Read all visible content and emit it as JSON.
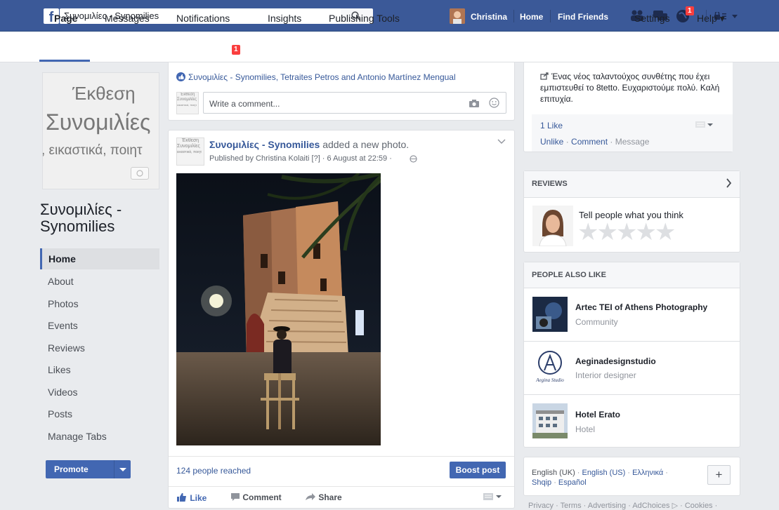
{
  "topbar": {
    "search_value": "Συνομιλίες - Synomilies",
    "user_name": "Christina",
    "nav_home": "Home",
    "nav_find_friends": "Find Friends",
    "notif_badge": "1",
    "brand_color": "#3b5998"
  },
  "pagenav": {
    "page": "Page",
    "messages": "Messages",
    "notifications": "Notifications",
    "notifications_badge": "1",
    "insights": "Insights",
    "publishing_tools": "Publishing Tools",
    "settings": "Settings",
    "help": "Help ▾"
  },
  "cover": {
    "line1": "Έκθεση",
    "line2": "Συνομιλίες",
    "line3": ", εικαστικά, ποιητ"
  },
  "sidebar": {
    "page_name": "Συνομιλίες - Synomilies",
    "items": [
      {
        "label": "Home"
      },
      {
        "label": "About"
      },
      {
        "label": "Photos"
      },
      {
        "label": "Events"
      },
      {
        "label": "Reviews"
      },
      {
        "label": "Likes"
      },
      {
        "label": "Videos"
      },
      {
        "label": "Posts"
      },
      {
        "label": "Manage Tabs"
      }
    ],
    "promote": "Promote"
  },
  "comment_card": {
    "likers": "Συνομιλίες - Synomilies, Tetraites Petros and Antonio Martínez Mengual",
    "placeholder": "Write a comment..."
  },
  "post": {
    "author": "Συνομιλίες - Synomilies",
    "action": "added a new photo.",
    "meta": "Published by Christina Kolaiti [?] · 6 August at 22:59 ·",
    "reached": "124 people reached",
    "boost": "Boost post",
    "like": "Like",
    "comment": "Comment",
    "share": "Share"
  },
  "thumb_text": {
    "l1": "Έκθεση",
    "l2": "Συνομιλίες",
    "l3": "εικαστικά, ποιητ"
  },
  "right_top": {
    "text": "Ένας νέος ταλαντούχος συνθέτης που έχει εμπιστευθεί το 8tetto. Ευχαριστούμε πολύ. Καλή επιτυχία.",
    "likes": "1 Like",
    "unlike": "Unlike",
    "comment": "Comment",
    "message": "Message",
    "sep": " · "
  },
  "reviews": {
    "header": "REVIEWS",
    "prompt": "Tell people what you think"
  },
  "people_also_like": {
    "header": "PEOPLE ALSO LIKE",
    "items": [
      {
        "name": "Artec TEI of Athens Photography",
        "category": "Community"
      },
      {
        "name": "Aeginadesignstudio",
        "category": "Interior designer",
        "logo_text": "Aegina Studio"
      },
      {
        "name": "Hotel Erato",
        "category": "Hotel"
      }
    ]
  },
  "languages": {
    "uk": "English (UK)",
    "us": "English (US)",
    "el": "Ελληνικά",
    "sq": "Shqip",
    "es": "Español",
    "sep": " · ",
    "add": "+"
  },
  "footer": {
    "links": "Privacy · Terms · Advertising · AdChoices ▷ · Cookies ·"
  }
}
